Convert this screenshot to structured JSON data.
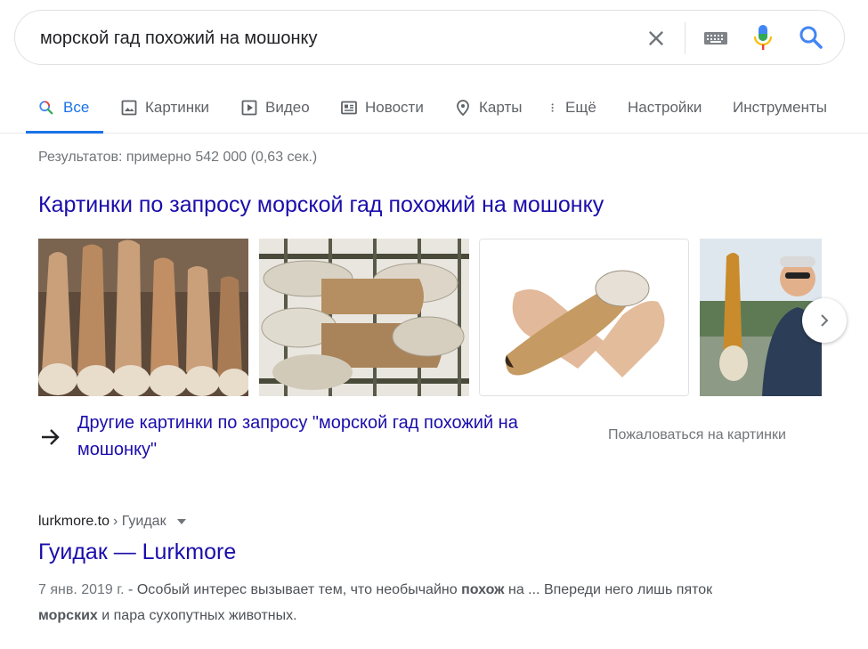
{
  "search": {
    "query": "морской гад похожий на мошонку"
  },
  "tabs": [
    {
      "label": "Все",
      "icon": "search-icon",
      "active": true
    },
    {
      "label": "Картинки",
      "icon": "image-icon"
    },
    {
      "label": "Видео",
      "icon": "play-icon"
    },
    {
      "label": "Новости",
      "icon": "news-icon"
    },
    {
      "label": "Карты",
      "icon": "map-pin-icon"
    },
    {
      "label": "Ещё",
      "icon": "more-vert-icon"
    },
    {
      "label": "Настройки"
    },
    {
      "label": "Инструменты"
    }
  ],
  "result_stats": "Результатов: примерно 542 000 (0,63 сек.)",
  "images_block": {
    "heading": "Картинки по запросу морской гад похожий на мошонку",
    "more_link": "Другие картинки по запросу \"морской гад похожий на мошонку\"",
    "report": "Пожаловаться на картинки"
  },
  "result": {
    "domain": "lurkmore.to",
    "path": "› Гуидак",
    "title": "Гуидак — Lurkmore",
    "date": "7 янв. 2019 г.",
    "snippet_1": " - Особый интерес вызывает тем, что необычайно ",
    "snippet_bold_1": "похож",
    "snippet_2": " на ... Впереди него лишь пяток ",
    "snippet_bold_2": "морских",
    "snippet_3": " и пара сухопутных животных."
  },
  "colors": {
    "link": "#1a0dab",
    "accent": "#1a73e8",
    "muted": "#70757a"
  }
}
